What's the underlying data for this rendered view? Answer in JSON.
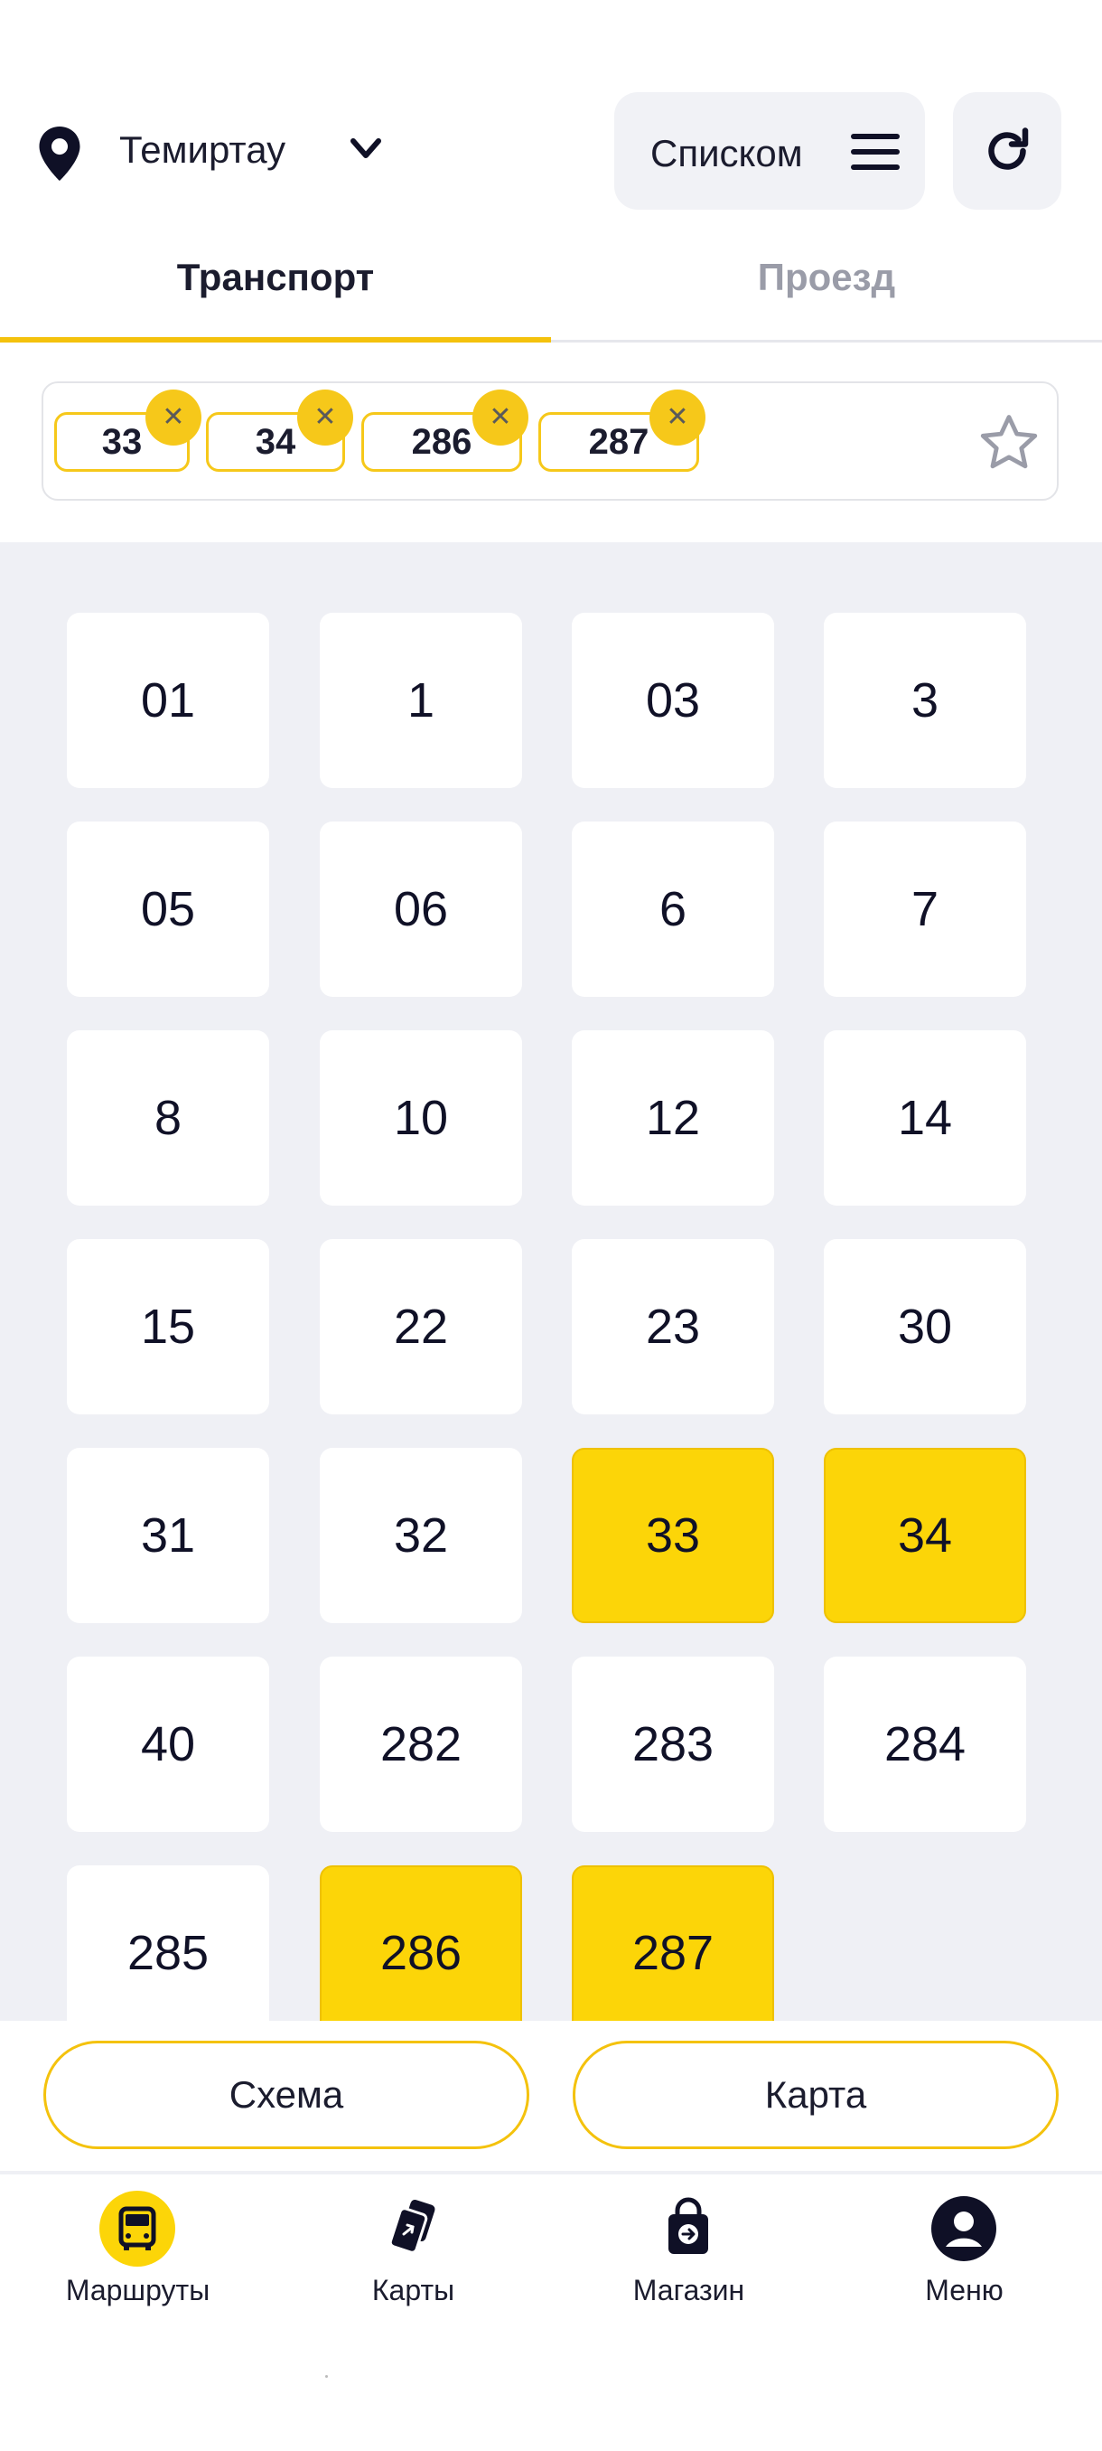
{
  "header": {
    "city": "Темиртау",
    "view_mode_label": "Списком"
  },
  "tabs": [
    {
      "label": "Транспорт",
      "active": true
    },
    {
      "label": "Проезд",
      "active": false
    }
  ],
  "favorites": {
    "chips": [
      "33",
      "34",
      "286",
      "287"
    ]
  },
  "routes": [
    {
      "label": "01",
      "selected": false
    },
    {
      "label": "1",
      "selected": false
    },
    {
      "label": "03",
      "selected": false
    },
    {
      "label": "3",
      "selected": false
    },
    {
      "label": "05",
      "selected": false
    },
    {
      "label": "06",
      "selected": false
    },
    {
      "label": "6",
      "selected": false
    },
    {
      "label": "7",
      "selected": false
    },
    {
      "label": "8",
      "selected": false
    },
    {
      "label": "10",
      "selected": false
    },
    {
      "label": "12",
      "selected": false
    },
    {
      "label": "14",
      "selected": false
    },
    {
      "label": "15",
      "selected": false
    },
    {
      "label": "22",
      "selected": false
    },
    {
      "label": "23",
      "selected": false
    },
    {
      "label": "30",
      "selected": false
    },
    {
      "label": "31",
      "selected": false
    },
    {
      "label": "32",
      "selected": false
    },
    {
      "label": "33",
      "selected": true
    },
    {
      "label": "34",
      "selected": true
    },
    {
      "label": "40",
      "selected": false
    },
    {
      "label": "282",
      "selected": false
    },
    {
      "label": "283",
      "selected": false
    },
    {
      "label": "284",
      "selected": false
    },
    {
      "label": "285",
      "selected": false
    },
    {
      "label": "286",
      "selected": true
    },
    {
      "label": "287",
      "selected": true
    }
  ],
  "actions": {
    "scheme_label": "Схема",
    "map_label": "Карта"
  },
  "nav": [
    {
      "label": "Маршруты",
      "icon": "bus-icon",
      "active": true
    },
    {
      "label": "Карты",
      "icon": "cards-icon",
      "active": false
    },
    {
      "label": "Магазин",
      "icon": "shop-bag-icon",
      "active": false
    },
    {
      "label": "Меню",
      "icon": "user-icon",
      "active": false
    }
  ],
  "colors": {
    "accent": "#fcd508",
    "grid_bg": "#eff0f5",
    "text": "#1b1c2e"
  }
}
